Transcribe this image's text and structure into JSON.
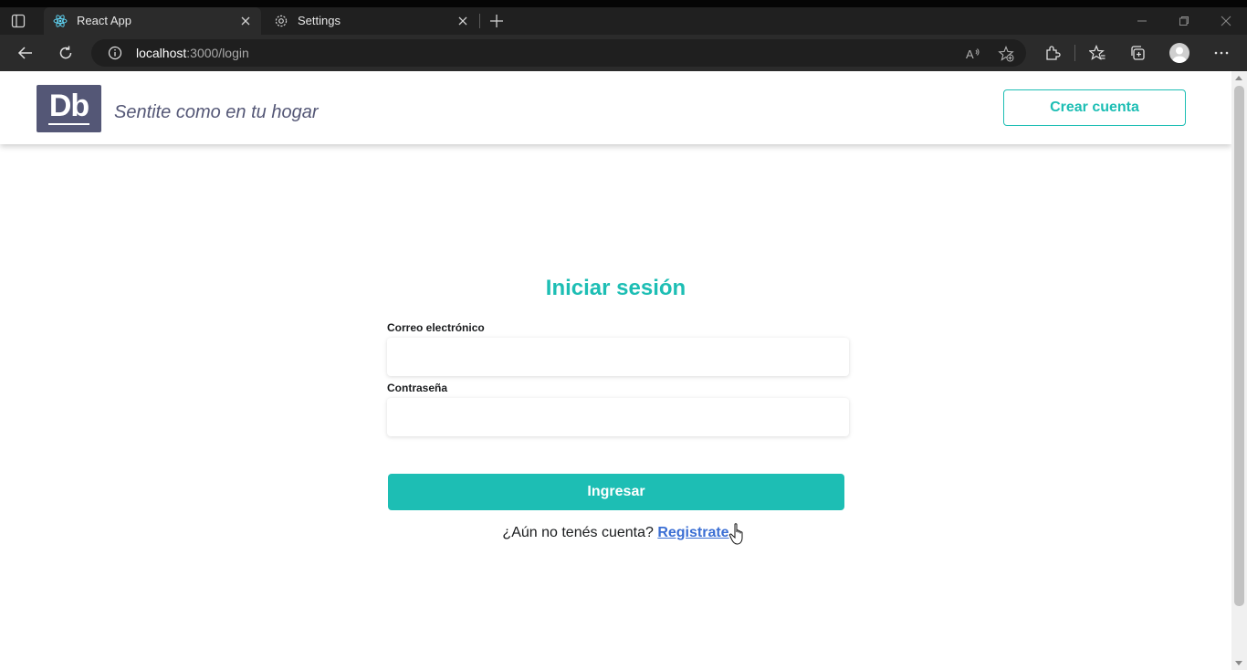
{
  "browser": {
    "tabs": [
      {
        "title": "React App"
      },
      {
        "title": "Settings"
      }
    ],
    "url_host": "localhost",
    "url_rest": ":3000/login"
  },
  "header": {
    "logo_text": "Db",
    "tagline": "Sentite como en tu hogar",
    "create_account_label": "Crear cuenta"
  },
  "login": {
    "title": "Iniciar sesión",
    "email_label": "Correo electrónico",
    "email_value": "",
    "password_label": "Contraseña",
    "password_value": "",
    "submit_label": "Ingresar",
    "no_account_text": "¿Aún no tenés cuenta?",
    "register_link": "Registrate"
  },
  "colors": {
    "accent": "#1dbeb4",
    "brand_dark": "#545776",
    "link": "#3b6fd4"
  },
  "icons": {
    "tab_actions": "tab-actions-icon",
    "react_favicon": "react-icon",
    "settings_favicon": "gear-icon",
    "close": "close-icon",
    "new_tab": "plus-icon",
    "back": "back-arrow-icon",
    "refresh": "refresh-icon",
    "info": "info-icon",
    "read_aloud": "read-aloud-icon",
    "add_favorite": "add-favorite-icon",
    "extensions": "extensions-icon",
    "favorites": "favorites-icon",
    "collections": "collections-icon",
    "profile": "profile-icon",
    "more": "more-icon"
  }
}
